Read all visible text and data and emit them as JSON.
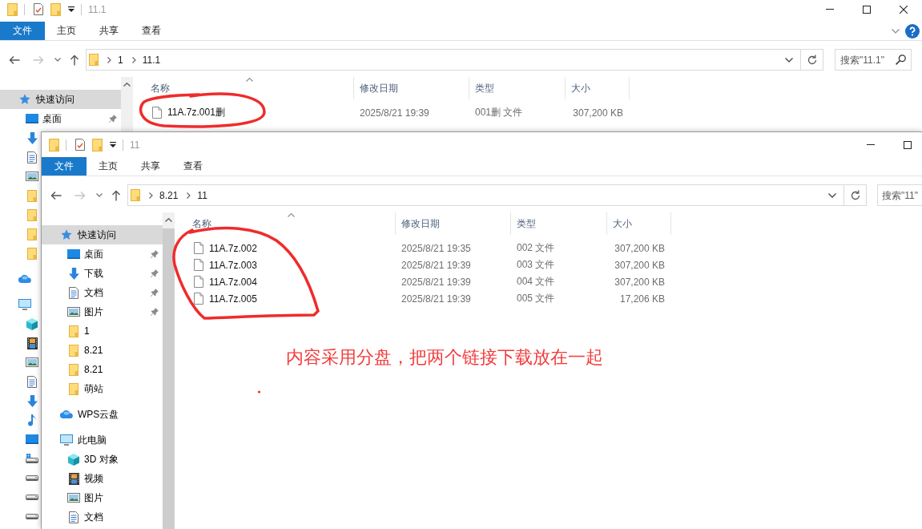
{
  "back_window": {
    "title": "11.1",
    "window_buttons": [
      {
        "kind": "minimize"
      },
      {
        "kind": "maximize"
      },
      {
        "kind": "close"
      }
    ],
    "ribbon_tabs": [
      {
        "label": "文件",
        "selected": true
      },
      {
        "label": "主页",
        "selected": false
      },
      {
        "label": "共享",
        "selected": false
      },
      {
        "label": "查看",
        "selected": false
      }
    ],
    "history": [
      {
        "kind": "back",
        "disabled": false
      },
      {
        "kind": "forward",
        "disabled": true
      },
      {
        "kind": "recent",
        "disabled": false
      },
      {
        "kind": "up",
        "disabled": false
      }
    ],
    "path": [
      "1",
      "11.1"
    ],
    "search": {
      "placeholder": "搜索\"11.1\""
    },
    "nav": [
      {
        "kind": "quick",
        "label": "快速访问",
        "selected": true,
        "children": [
          {
            "kind": "desktop",
            "label": "桌面",
            "pinned": true,
            "selected": false
          },
          {
            "kind": "downloads",
            "selected": false
          },
          {
            "kind": "documents",
            "selected": false
          },
          {
            "kind": "pictures",
            "selected": false
          },
          {
            "kind": "folder",
            "selected": false
          },
          {
            "kind": "folder",
            "selected": false
          },
          {
            "kind": "folder",
            "selected": false
          },
          {
            "kind": "folder",
            "selected": false
          }
        ]
      },
      {
        "kind": "cloud",
        "selected": false
      },
      {
        "kind": "computer",
        "selected": false,
        "children": [
          {
            "kind": "objects",
            "selected": false
          },
          {
            "kind": "videos",
            "selected": false
          },
          {
            "kind": "pictures",
            "selected": false
          },
          {
            "kind": "documents",
            "selected": false
          },
          {
            "kind": "downloads",
            "selected": false
          },
          {
            "kind": "music",
            "selected": false
          },
          {
            "kind": "desktop",
            "selected": false
          },
          {
            "kind": "sysdrive",
            "selected": false
          },
          {
            "kind": "drive",
            "selected": false
          },
          {
            "kind": "drive",
            "selected": false
          },
          {
            "kind": "drive",
            "selected": false
          }
        ]
      }
    ],
    "columns": [
      {
        "label": "名称",
        "sorted": true
      },
      {
        "label": "修改日期",
        "sorted": false
      },
      {
        "label": "类型",
        "sorted": false
      },
      {
        "label": "大小",
        "sorted": false
      }
    ],
    "files": [
      {
        "name": "11A.7z.001删",
        "modified": "2025/8/21 19:39",
        "type": "001删 文件",
        "size": "307,200 KB"
      }
    ]
  },
  "front_window": {
    "title": "11",
    "window_buttons": [
      {
        "kind": "minimize"
      },
      {
        "kind": "maximize"
      }
    ],
    "ribbon_tabs": [
      {
        "label": "文件",
        "selected": true
      },
      {
        "label": "主页",
        "selected": false
      },
      {
        "label": "共享",
        "selected": false
      },
      {
        "label": "查看",
        "selected": false
      }
    ],
    "history": [
      {
        "kind": "back",
        "disabled": false
      },
      {
        "kind": "forward",
        "disabled": true
      },
      {
        "kind": "recent",
        "disabled": false
      },
      {
        "kind": "up",
        "disabled": false
      }
    ],
    "path": [
      "8.21",
      "11"
    ],
    "search": {
      "placeholder": "搜索\"11\""
    },
    "nav": [
      {
        "kind": "quick",
        "label": "快速访问",
        "selected": true,
        "children": [
          {
            "kind": "desktop",
            "label": "桌面",
            "pinned": true,
            "selected": false
          },
          {
            "kind": "downloads",
            "label": "下载",
            "pinned": true,
            "selected": false
          },
          {
            "kind": "documents",
            "label": "文档",
            "pinned": true,
            "selected": false
          },
          {
            "kind": "pictures",
            "label": "图片",
            "pinned": true,
            "selected": false
          },
          {
            "kind": "folder",
            "label": "1",
            "pinned": false,
            "selected": false
          },
          {
            "kind": "folder",
            "label": "8.21",
            "pinned": false,
            "selected": false
          },
          {
            "kind": "folder",
            "label": "8.21",
            "pinned": false,
            "selected": false
          },
          {
            "kind": "folder",
            "label": "萌站",
            "pinned": false,
            "selected": false
          }
        ]
      },
      {
        "kind": "cloud",
        "label": "WPS云盘",
        "selected": false
      },
      {
        "kind": "computer",
        "label": "此电脑",
        "selected": false,
        "children": [
          {
            "kind": "objects",
            "label": "3D 对象",
            "selected": false
          },
          {
            "kind": "videos",
            "label": "视频",
            "selected": false
          },
          {
            "kind": "pictures",
            "label": "图片",
            "selected": false
          },
          {
            "kind": "documents",
            "label": "文档",
            "selected": false
          }
        ]
      }
    ],
    "columns": [
      {
        "label": "名称",
        "sorted": true
      },
      {
        "label": "修改日期",
        "sorted": false
      },
      {
        "label": "类型",
        "sorted": false
      },
      {
        "label": "大小",
        "sorted": false
      }
    ],
    "files": [
      {
        "name": "11A.7z.002",
        "modified": "2025/8/21 19:35",
        "type": "002 文件",
        "size": "307,200 KB"
      },
      {
        "name": "11A.7z.003",
        "modified": "2025/8/21 19:39",
        "type": "003 文件",
        "size": "307,200 KB"
      },
      {
        "name": "11A.7z.004",
        "modified": "2025/8/21 19:39",
        "type": "004 文件",
        "size": "307,200 KB"
      },
      {
        "name": "11A.7z.005",
        "modified": "2025/8/21 19:39",
        "type": "005 文件",
        "size": "17,206 KB"
      }
    ]
  },
  "annotation": {
    "note": "内容采用分盘，把两个链接下载放在一起"
  }
}
